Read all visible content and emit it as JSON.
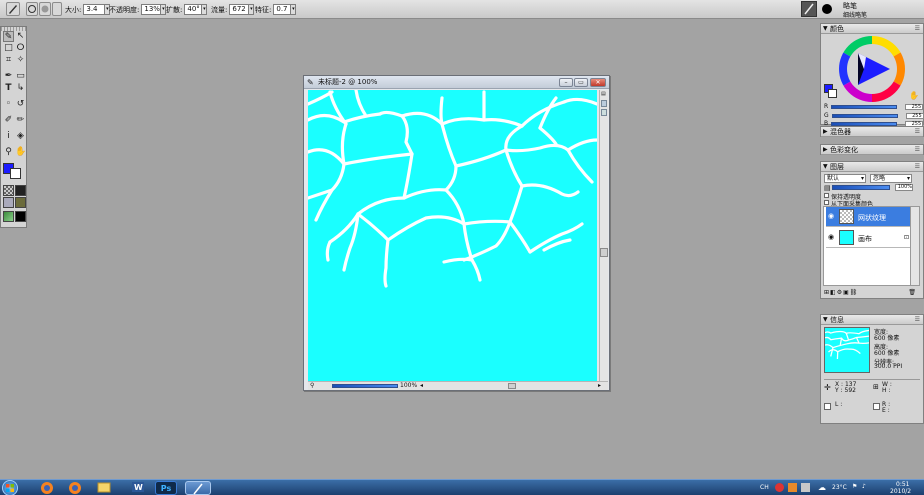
{
  "propbar": {
    "size_label": "大小:",
    "size_value": "3.4",
    "opacity_label": "不透明度:",
    "opacity_value": "13%",
    "spread_label": "扩散:",
    "spread_value": "40°",
    "flow_label": "流量:",
    "flow_value": "672",
    "feature_label": "特征:",
    "feature_value": "0.7"
  },
  "top_right": {
    "line1": "略笔",
    "line2": "细线略笔"
  },
  "document": {
    "title": "未标题-2 @ 100%",
    "zoom": "100%"
  },
  "color_panel": {
    "title": "颜色",
    "r_label": "R",
    "g_label": "G",
    "b_label": "B",
    "r_value": "255",
    "g_value": "255",
    "b_value": "255"
  },
  "mixer_panel": {
    "title": "混色器"
  },
  "color_var_panel": {
    "title": "色彩变化"
  },
  "layers_panel": {
    "title": "图层",
    "blend_mode": "默认",
    "composite": "忽略",
    "opacity": "100%",
    "preserve_transparency": "保持透明度",
    "pick_up_underlying": "从下面采集颜色",
    "layers": [
      {
        "name": "网状纹理",
        "selected": true
      },
      {
        "name": "画布",
        "selected": false
      }
    ]
  },
  "info_panel": {
    "title": "信息",
    "width_label": "宽度:",
    "width_value": "600 像素",
    "height_label": "高度:",
    "height_value": "600 像素",
    "resolution_label": "分辨率:",
    "resolution_value": "300.0 PPI",
    "x_label": "X :",
    "x_value": "137",
    "y_label": "Y :",
    "y_value": "592",
    "w_label": "W :",
    "h_label": "H :",
    "l_label": "L :",
    "r_label": "R :",
    "e_label": "E :"
  },
  "taskbar": {
    "ps_label": "Ps",
    "lang": "CH",
    "temp": "23°C",
    "time": "0:51",
    "date": "2010/2"
  },
  "colors": {
    "canvas": "#1affff",
    "primary": "#1c1cff",
    "secondary": "#ffffff",
    "selection": "#3b7de0"
  }
}
